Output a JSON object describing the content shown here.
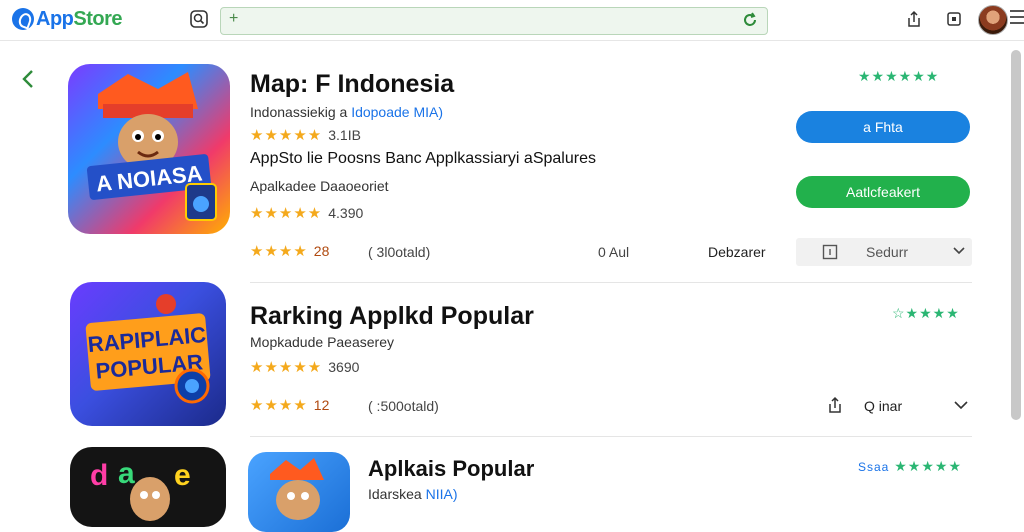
{
  "header": {
    "logo_a": "App",
    "logo_b": "Store",
    "search_value": ""
  },
  "apps": [
    {
      "title": "Map: F Indonesia",
      "developer": "Indonassiekig a",
      "developer_link": "Idopoade MIA)",
      "rating_stars": "★★★★★",
      "rating_value": "3.1IB",
      "description": "AppSto lie Poosns Banc Applkassiaryi aSpalures",
      "category": "Apalkadee",
      "category_extra": "Daaoeoriet",
      "rating2_stars": "★★★★★",
      "rating2_value": "4.390",
      "footer_stars": "★★★★",
      "footer_count": "28",
      "footer_reviews": "( 3l0otald)",
      "footer_age": "0 Aul",
      "footer_dev": "Debzarer",
      "dropdown_label": "Sedurr",
      "right_stars": "★★★★★★",
      "button_primary": "a Fhta",
      "button_secondary": "Aatlcfeakert"
    },
    {
      "title": "Rarking  Applkd Popular",
      "developer": "Mopkadude",
      "developer_extra": "Paeaserey",
      "rating_stars": "★★★★★",
      "rating_value": "3690",
      "footer_stars": "★★★★",
      "footer_count": "12",
      "footer_reviews": "( :500otald)",
      "share_label": "Q inar",
      "right_stars": "☆★★★★"
    },
    {
      "title": "Aplkais Popular",
      "developer": "Idarskea",
      "developer_link": "NIIA)",
      "right_stars": "★★★★★",
      "right_lead": "Ssaa"
    }
  ],
  "colors": {
    "accent_blue": "#1a82e0",
    "accent_green": "#22b14c",
    "star_gold": "#f4a91c",
    "star_green": "#2bb673"
  }
}
